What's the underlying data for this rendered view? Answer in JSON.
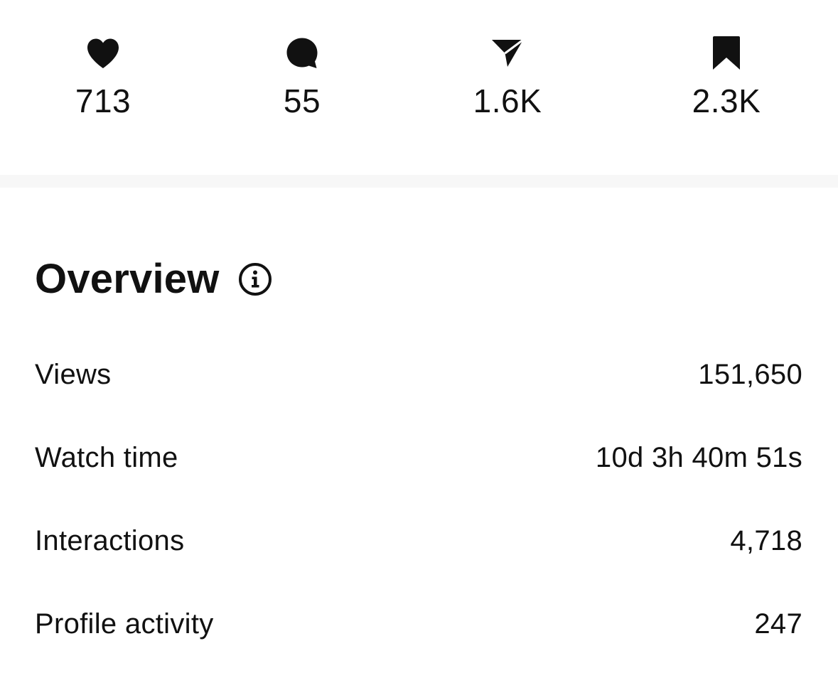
{
  "engagement": {
    "likes": {
      "icon": "heart-icon",
      "count": "713"
    },
    "comments": {
      "icon": "comment-icon",
      "count": "55"
    },
    "shares": {
      "icon": "send-icon",
      "count": "1.6K"
    },
    "saves": {
      "icon": "bookmark-icon",
      "count": "2.3K"
    }
  },
  "overview": {
    "title": "Overview",
    "info_icon": "info-icon",
    "metrics": [
      {
        "label": "Views",
        "value": "151,650"
      },
      {
        "label": "Watch time",
        "value": "10d 3h 40m 51s"
      },
      {
        "label": "Interactions",
        "value": "4,718"
      },
      {
        "label": "Profile activity",
        "value": "247"
      }
    ]
  },
  "colors": {
    "text": "#111111",
    "divider": "#f7f7f7",
    "background": "#ffffff"
  }
}
